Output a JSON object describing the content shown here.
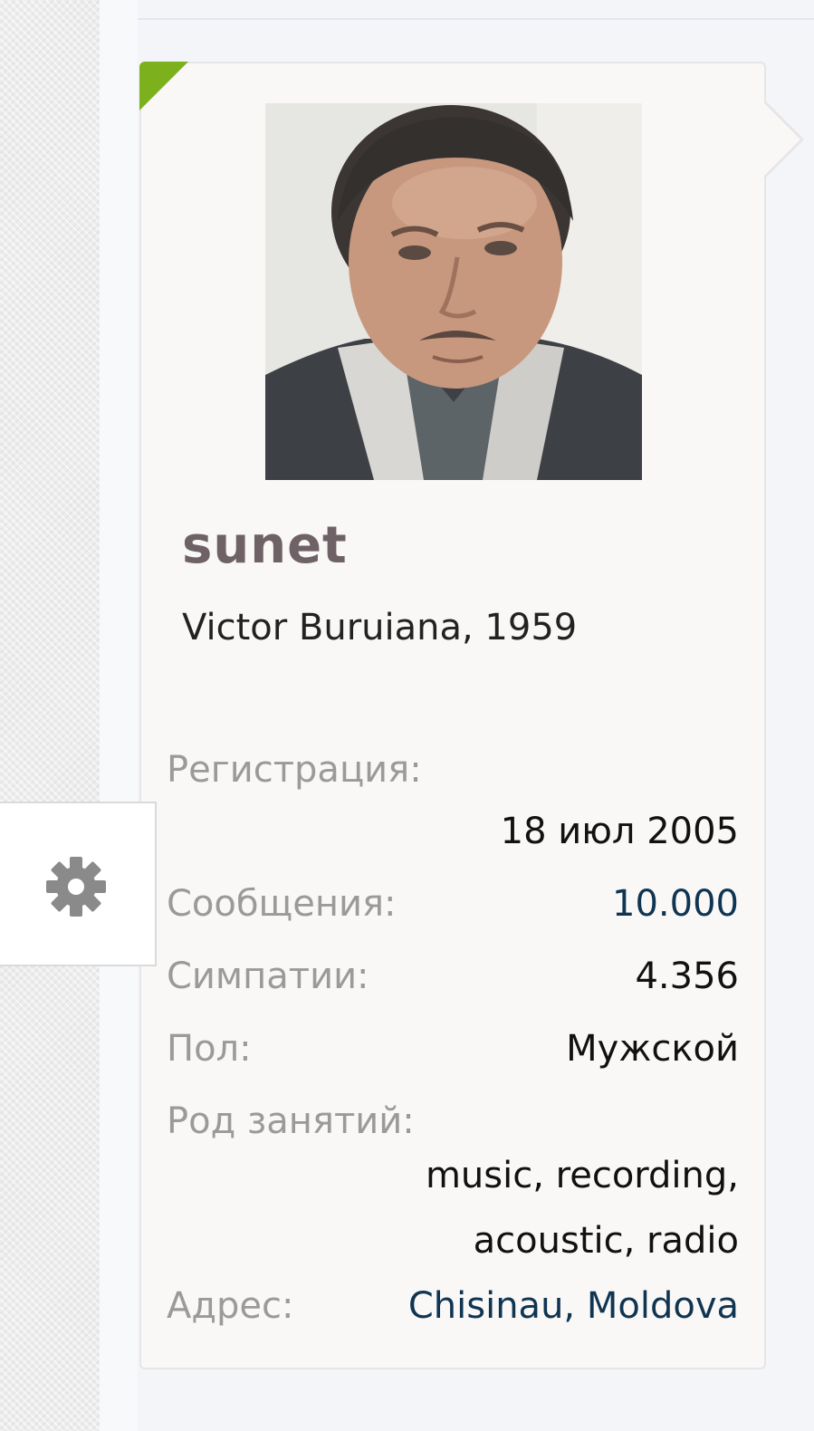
{
  "profile": {
    "username": "sunet",
    "real_name": "Victor Buruiana, 1959",
    "accent_color": "#7cb11d"
  },
  "stats": {
    "registration_label": "Регистрация:",
    "registration_value": "18 июл 2005",
    "messages_label": "Сообщения:",
    "messages_value": "10.000",
    "likes_label": "Симпатии:",
    "likes_value": "4.356",
    "gender_label": "Пол:",
    "gender_value": "Мужской",
    "occupation_label": "Род занятий:",
    "occupation_line1": "music, recording,",
    "occupation_line2": "acoustic, radio",
    "address_label": "Адрес:",
    "address_value": "Chisinau, Moldova"
  },
  "settings": {
    "icon": "gear-icon"
  }
}
